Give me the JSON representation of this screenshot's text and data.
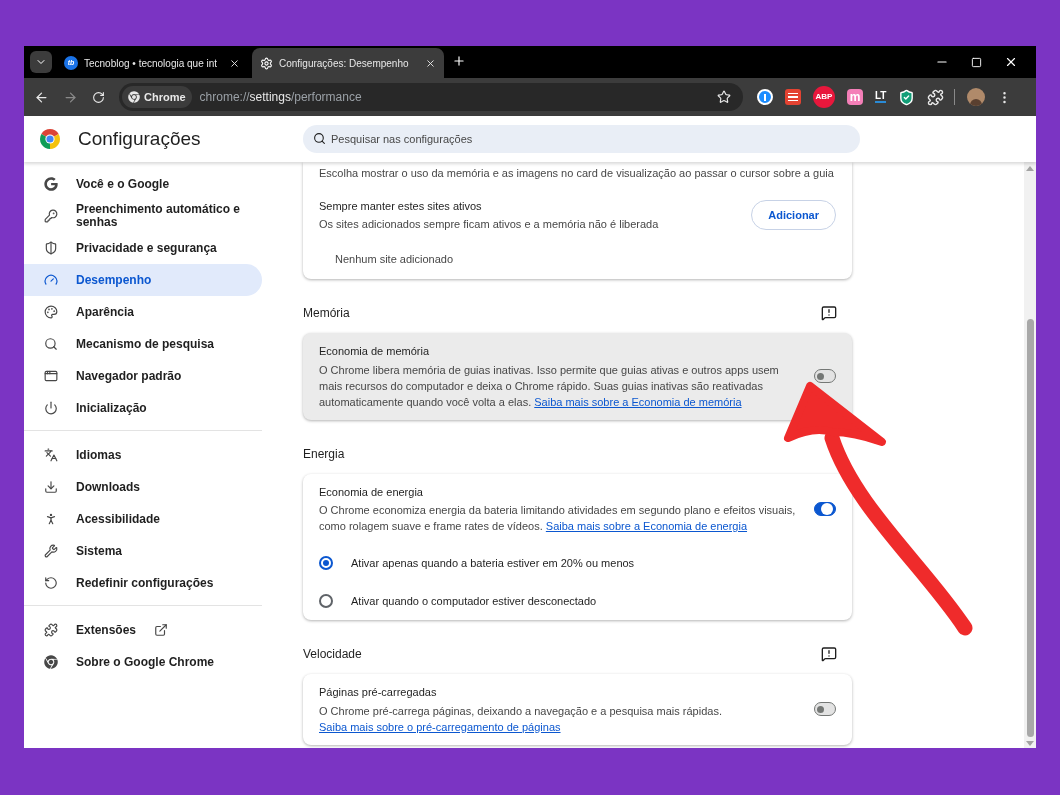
{
  "browser": {
    "tabs": [
      {
        "kind": "site",
        "favicon_label": "tb",
        "title": "Tecnoblog • tecnologia que int",
        "selected": false
      },
      {
        "kind": "settings",
        "title": "Configurações: Desempenho",
        "selected": true
      }
    ],
    "address": {
      "chip": "Chrome",
      "scheme": "chrome://",
      "host": "settings",
      "path": "/performance"
    },
    "extensions": [
      {
        "kind": "onepassword"
      },
      {
        "kind": "todo"
      },
      {
        "kind": "abp",
        "label": "ABP"
      },
      {
        "kind": "m",
        "label": "m"
      },
      {
        "kind": "lt",
        "label": "LT"
      },
      {
        "kind": "shield"
      },
      {
        "kind": "puzzle"
      }
    ]
  },
  "settings": {
    "title": "Configurações",
    "search": {
      "placeholder": "Pesquisar nas configurações"
    },
    "nav": [
      [
        {
          "kind": "google",
          "label": "Você e o Google",
          "selected": false
        },
        {
          "kind": "key",
          "label": "Preenchimento automático e senhas",
          "selected": false
        },
        {
          "kind": "shield",
          "label": "Privacidade e segurança",
          "selected": false
        },
        {
          "kind": "gauge",
          "label": "Desempenho",
          "selected": true
        },
        {
          "kind": "palette",
          "label": "Aparência",
          "selected": false
        },
        {
          "kind": "search",
          "label": "Mecanismo de pesquisa",
          "selected": false
        },
        {
          "kind": "browser",
          "label": "Navegador padrão",
          "selected": false
        },
        {
          "kind": "power",
          "label": "Inicialização",
          "selected": false
        }
      ],
      [
        {
          "kind": "languages",
          "label": "Idiomas",
          "selected": false
        },
        {
          "kind": "download",
          "label": "Downloads",
          "selected": false
        },
        {
          "kind": "accessibility",
          "label": "Acessibilidade",
          "selected": false
        },
        {
          "kind": "wrench",
          "label": "Sistema",
          "selected": false
        },
        {
          "kind": "reset",
          "label": "Redefinir configurações",
          "selected": false
        }
      ],
      [
        {
          "kind": "puzzle",
          "label": "Extensões",
          "selected": false,
          "external": true
        },
        {
          "kind": "chrome",
          "label": "Sobre o Google Chrome",
          "selected": false
        }
      ]
    ],
    "content": [
      {
        "kind": "card",
        "highlighted": false,
        "rows": [
          {
            "kind": "description",
            "text": "Escolha mostrar o uso da memória e as imagens no card de visualização ao passar o cursor sobre a guia"
          },
          {
            "kind": "action",
            "title": "Sempre manter estes sites ativos",
            "text": "Os sites adicionados sempre ficam ativos e a memória não é liberada",
            "button": "Adicionar"
          },
          {
            "kind": "note",
            "text": "Nenhum site adicionado"
          }
        ]
      },
      {
        "kind": "heading",
        "title": "Memória",
        "feedback": true
      },
      {
        "kind": "card",
        "highlighted": true,
        "rows": [
          {
            "kind": "toggle",
            "title": "Economia de memória",
            "text": "O Chrome libera memória de guias inativas. Isso permite que guias ativas e outros apps usem mais recursos do computador e deixa o Chrome rápido. Suas guias inativas são reativadas automaticamente quando você volta a elas.",
            "link": "Saiba mais sobre a Economia de memória",
            "on": false
          }
        ]
      },
      {
        "kind": "heading",
        "title": "Energia",
        "feedback": false
      },
      {
        "kind": "card",
        "highlighted": false,
        "rows": [
          {
            "kind": "toggle",
            "title": "Economia de energia",
            "text": "O Chrome economiza energia da bateria limitando atividades em segundo plano e efeitos visuais, como rolagem suave e frame rates de vídeos.",
            "link": "Saiba mais sobre a Economia de energia",
            "on": true
          },
          {
            "kind": "radio",
            "label": "Ativar apenas quando a bateria estiver em 20% ou menos",
            "selected": true
          },
          {
            "kind": "radio",
            "label": "Ativar quando o computador estiver desconectado",
            "selected": false
          }
        ]
      },
      {
        "kind": "heading",
        "title": "Velocidade",
        "feedback": true
      },
      {
        "kind": "card",
        "highlighted": false,
        "rows": [
          {
            "kind": "toggle",
            "title": "Páginas pré-carregadas",
            "text": "O Chrome pré-carrega páginas, deixando a navegação e a pesquisa mais rápidas.",
            "link": "Saiba mais sobre o pré-carregamento de páginas",
            "on": false
          }
        ]
      }
    ]
  }
}
